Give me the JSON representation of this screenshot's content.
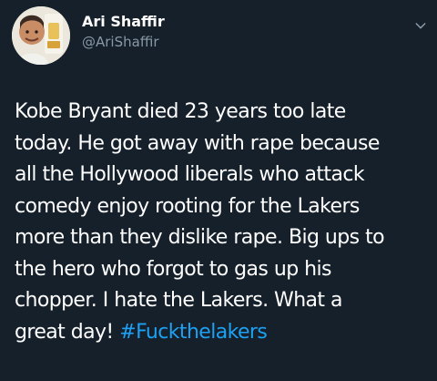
{
  "tweet": {
    "author": {
      "display_name": "Ari Shaffir",
      "handle": "@AriShaffir",
      "avatar_icon": "user-avatar"
    },
    "menu_icon": "chevron-down-icon",
    "text_lines": [
      "Kobe Bryant died 23 years too late",
      "today. He got away with rape because",
      "all the Hollywood liberals who attack",
      "comedy enjoy rooting for the Lakers",
      "more than they dislike rape. Big ups to",
      "the hero who forgot to gas up his",
      "chopper. I hate the Lakers. What a",
      "great day! "
    ],
    "hashtag": "#Fuckthelakers"
  },
  "colors": {
    "background": "#15202b",
    "text": "#ffffff",
    "secondary_text": "#8899a6",
    "link": "#1da1f2"
  }
}
